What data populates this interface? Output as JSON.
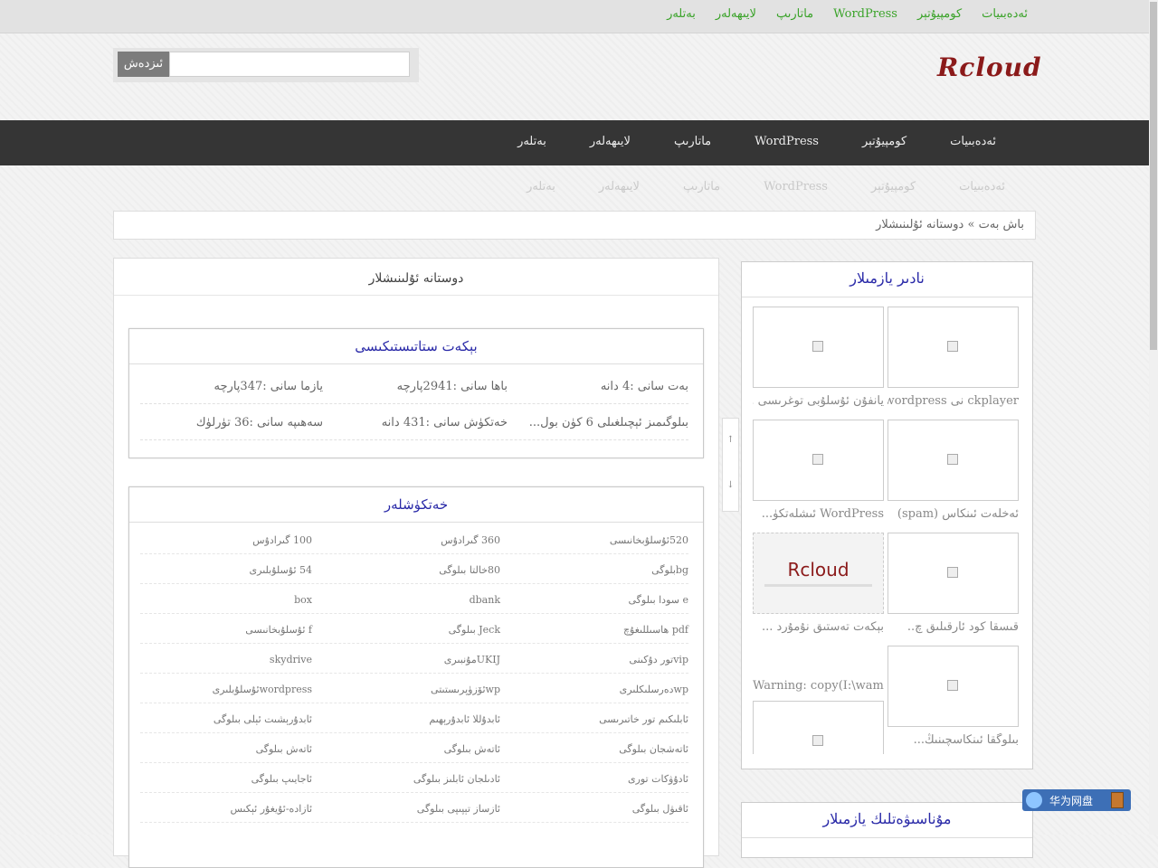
{
  "topnav": [
    "ئەدەبىيات",
    "كومپيۇتېر",
    "WordPress",
    "ماتارىپ",
    "لايىھەلەر",
    "بەتلەر"
  ],
  "search": {
    "button": "ئىزدەش",
    "placeholder": ""
  },
  "logo": "Rcloud",
  "mainnav": [
    "ئەدەبىيات",
    "كومپيۇتېر",
    "WordPress",
    "ماتارىپ",
    "لايىھەلەر",
    "بەتلەر"
  ],
  "breadcrumb": {
    "home": "باش بەت",
    "sep": "»",
    "current": "دوستانە ئۇلىنىشلار"
  },
  "page_title": "دوستانە ئۇلىنىشلار",
  "stats": {
    "title": "بېكەت ستاتىستىكىسى",
    "items": [
      {
        "label": "بەت سانى",
        "value": "4 دانە"
      },
      {
        "label": "باھا سانى",
        "value": "2941پارچە"
      },
      {
        "label": "يازما سانى",
        "value": "347پارچە"
      },
      {
        "label": "بىلوگىمىز ئېچىلغىلى",
        "value": "6 كۈن بول..."
      },
      {
        "label": "خەتكۈش سانى",
        "value": "431 دانە"
      },
      {
        "label": "سەھىپە سانى",
        "value": "36 تۈرلۈك"
      }
    ]
  },
  "links": {
    "title": "خەتكۈشلەر",
    "rows": [
      [
        "520ئۇسلۇبخانىسى",
        "360 گىرادۇس",
        "100 گىرادۇس"
      ],
      [
        "bgبلوگى",
        "80خالتا بىلوگى",
        "54 ئۇسلۇبلىرى"
      ],
      [
        "e سودا بىلوگى",
        "dbank",
        "box"
      ],
      [
        "pdf ھاسىللىغۇچ",
        "Jeck بىلوگى",
        "f ئۇسلۇبخانىسى"
      ],
      [
        "vipتور دۇكىنى",
        "UKIJمۇنبىرى",
        "skydrive"
      ],
      [
        "wpدەرسلىكلىرى",
        "wpئۆزۈپرىستىتى",
        "wordpressئۇسلۇبلىرى"
      ],
      [
        "ئابلىكىم تور خاتىرىسى",
        "ئابدۇللا ئابدۇرېھىم",
        "ئابدۇرېشىت ئېلى بىلوگى"
      ],
      [
        "ئاتەشجان بىلوگى",
        "ئاتەش بىلوگى",
        "ئاتەش بىلوگى"
      ],
      [
        "ئادۇۋكات تورى",
        "ئادىلجان ئابلىز بىلوگى",
        "ئاجايىپ بىلوگى"
      ],
      [
        "ئاقىۋل بىلوگى",
        "ئازساز تېپىپى بىلوگى",
        "ئازادە-ئۇيغۇر ئېكىس"
      ]
    ]
  },
  "sidebar": {
    "title": "نادىر يازمىلار",
    "posts": [
      {
        "caption": "ckplayer نى wordpress"
      },
      {
        "caption": "يانفۇن ئۇسلۇبى توغرىسى .."
      },
      {
        "caption": "ئەخلەت ئىنكاس (spam)"
      },
      {
        "caption": "WordPress ئىشلەتكۈ..."
      },
      {
        "caption": "قىسقا كود ئارقىلىق چ.."
      },
      {
        "caption": "بېكەت تەستىق نۇمۇرد ..."
      },
      {
        "caption": "بىلوگقا ئىنكاسچىنىڭ..."
      },
      {
        "caption": "Warning: copy(I:\\wamp\\w"
      }
    ],
    "rcloud_thumb": "Rcloud",
    "title2": "مۇناسىۋەتلىك يازمىلار"
  },
  "scroll_controls": {
    "up": "↑",
    "down": "↓"
  },
  "huawei": {
    "label": "华为网盘"
  }
}
